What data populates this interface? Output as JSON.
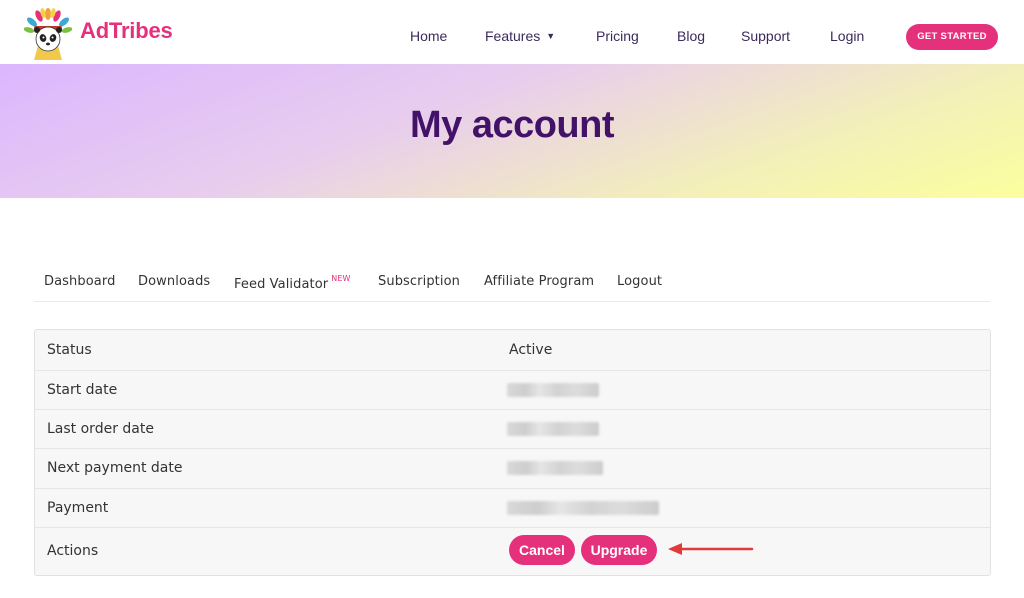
{
  "brand": {
    "name": "AdTribes",
    "accent": "#e5307b"
  },
  "nav": {
    "items": [
      {
        "label": "Home"
      },
      {
        "label": "Features",
        "caret": "▼"
      },
      {
        "label": "Pricing"
      },
      {
        "label": "Blog"
      },
      {
        "label": "Support"
      },
      {
        "label": "Login"
      }
    ],
    "cta_label": "GET STARTED"
  },
  "hero": {
    "title": "My account"
  },
  "account_tabs": [
    {
      "label": "Dashboard"
    },
    {
      "label": "Downloads"
    },
    {
      "label": "Feed Validator",
      "badge": "NEW"
    },
    {
      "label": "Subscription"
    },
    {
      "label": "Affiliate Program"
    },
    {
      "label": "Logout"
    }
  ],
  "subscription": {
    "rows": [
      {
        "label": "Status",
        "value": "Active"
      },
      {
        "label": "Start date",
        "value_redacted": true
      },
      {
        "label": "Last order date",
        "value_redacted": true
      },
      {
        "label": "Next payment date",
        "value_redacted": true
      },
      {
        "label": "Payment",
        "value_redacted": true
      },
      {
        "label": "Actions"
      }
    ],
    "actions": {
      "cancel_label": "Cancel",
      "upgrade_label": "Upgrade"
    }
  },
  "icons": {
    "logo": "panda-headdress-logo",
    "annotation": "red-arrow-icon"
  }
}
